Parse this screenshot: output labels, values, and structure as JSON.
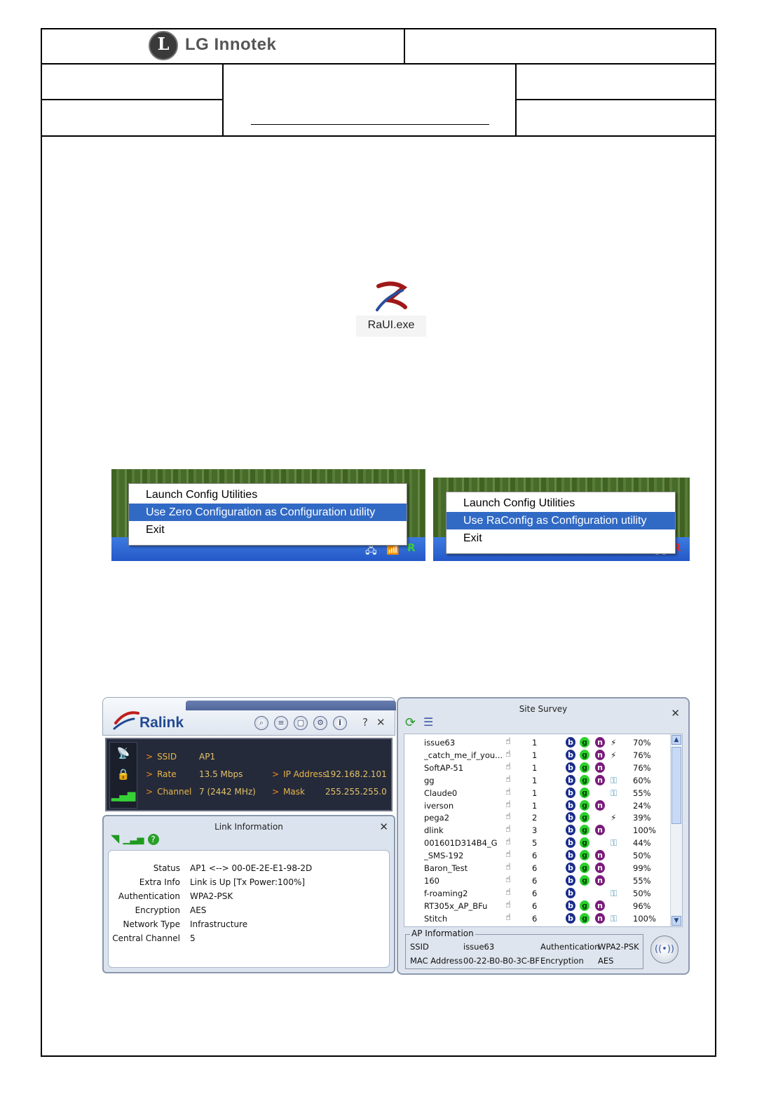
{
  "header": {
    "logo_glyph": "L",
    "company": "LG Innotek"
  },
  "desktop_icon": {
    "label": "RaUI.exe"
  },
  "menu_left": {
    "items": [
      "Launch Config Utilities",
      "Use Zero Configuration as Configuration utility",
      "Exit"
    ],
    "selected_index": 1
  },
  "menu_right": {
    "items": [
      "Launch Config Utilities",
      "Use RaConfig as Configuration utility",
      "Exit"
    ],
    "selected_index": 1
  },
  "ralink": {
    "brand": "Ralink",
    "toolbar_buttons": [
      "search-icon",
      "list-icon",
      "profile-icon",
      "settings-icon",
      "info-icon"
    ],
    "toolbar_glyphs": [
      "⌕",
      "≡",
      "▢",
      "⚙",
      "i"
    ],
    "help_label": "?",
    "close_label": "✕",
    "status": {
      "ssid_label": "SSID",
      "ssid": "AP1",
      "rate_label": "Rate",
      "rate": "13.5 Mbps",
      "channel_label": "Channel",
      "channel": "7 (2442 MHz)",
      "ip_label": "IP Address",
      "ip": "192.168.2.101",
      "mask_label": "Mask",
      "mask": "255.255.255.0"
    }
  },
  "link_info": {
    "title": "Link Information",
    "close_label": "✕",
    "rows": [
      {
        "label": "Status",
        "value": "AP1 <--> 00-0E-2E-E1-98-2D"
      },
      {
        "label": "Extra Info",
        "value": "Link is Up  [Tx Power:100%]"
      },
      {
        "label": "Authentication",
        "value": "WPA2-PSK"
      },
      {
        "label": "Encryption",
        "value": "AES"
      },
      {
        "label": "Network Type",
        "value": "Infrastructure"
      },
      {
        "label": "Central Channel",
        "value": "5"
      }
    ]
  },
  "site_survey": {
    "title": "Site Survey",
    "close_label": "✕",
    "networks": [
      {
        "ssid": "issue63",
        "channel": "1",
        "b": true,
        "g": true,
        "n": true,
        "wps": true,
        "lock": false,
        "signal": "70%"
      },
      {
        "ssid": "_catch_me_if_you...",
        "channel": "1",
        "b": true,
        "g": true,
        "n": true,
        "wps": true,
        "lock": false,
        "signal": "76%"
      },
      {
        "ssid": "SoftAP-51",
        "channel": "1",
        "b": true,
        "g": true,
        "n": true,
        "wps": false,
        "lock": false,
        "signal": "76%"
      },
      {
        "ssid": "gg",
        "channel": "1",
        "b": true,
        "g": true,
        "n": true,
        "wps": false,
        "lock": true,
        "signal": "60%"
      },
      {
        "ssid": "Claude0",
        "channel": "1",
        "b": true,
        "g": true,
        "n": false,
        "wps": false,
        "lock": true,
        "signal": "55%"
      },
      {
        "ssid": "iverson",
        "channel": "1",
        "b": true,
        "g": true,
        "n": true,
        "wps": false,
        "lock": false,
        "signal": "24%"
      },
      {
        "ssid": "pega2",
        "channel": "2",
        "b": true,
        "g": true,
        "n": false,
        "wps": true,
        "lock": false,
        "signal": "39%"
      },
      {
        "ssid": "dlink",
        "channel": "3",
        "b": true,
        "g": true,
        "n": true,
        "wps": false,
        "lock": false,
        "signal": "100%"
      },
      {
        "ssid": "001601D314B4_G",
        "channel": "5",
        "b": true,
        "g": true,
        "n": false,
        "wps": false,
        "lock": true,
        "signal": "44%"
      },
      {
        "ssid": "_SMS-192",
        "channel": "6",
        "b": true,
        "g": true,
        "n": true,
        "wps": false,
        "lock": false,
        "signal": "50%"
      },
      {
        "ssid": "Baron_Test",
        "channel": "6",
        "b": true,
        "g": true,
        "n": true,
        "wps": false,
        "lock": false,
        "signal": "99%"
      },
      {
        "ssid": "160",
        "channel": "6",
        "b": true,
        "g": true,
        "n": true,
        "wps": false,
        "lock": false,
        "signal": "55%"
      },
      {
        "ssid": "f-roaming2",
        "channel": "6",
        "b": true,
        "g": false,
        "n": false,
        "wps": false,
        "lock": true,
        "signal": "50%"
      },
      {
        "ssid": "RT305x_AP_BFu",
        "channel": "6",
        "b": true,
        "g": true,
        "n": true,
        "wps": false,
        "lock": false,
        "signal": "96%"
      },
      {
        "ssid": "Stitch",
        "channel": "6",
        "b": true,
        "g": true,
        "n": true,
        "wps": false,
        "lock": true,
        "signal": "100%"
      }
    ],
    "ap_info": {
      "legend": "AP Information",
      "ssid_label": "SSID",
      "ssid": "issue63",
      "mac_label": "MAC Address",
      "mac": "00-22-B0-B0-3C-BF",
      "auth_label": "Authentication",
      "auth": "WPA2-PSK",
      "enc_label": "Encryption",
      "enc": "AES"
    }
  },
  "colors": {
    "menu_highlight": "#316ac5",
    "ralink_status_text": "#e8b74a",
    "badge_b": "#1b2e8c",
    "badge_g": "#2bd12b",
    "badge_n": "#7a1b7a"
  }
}
